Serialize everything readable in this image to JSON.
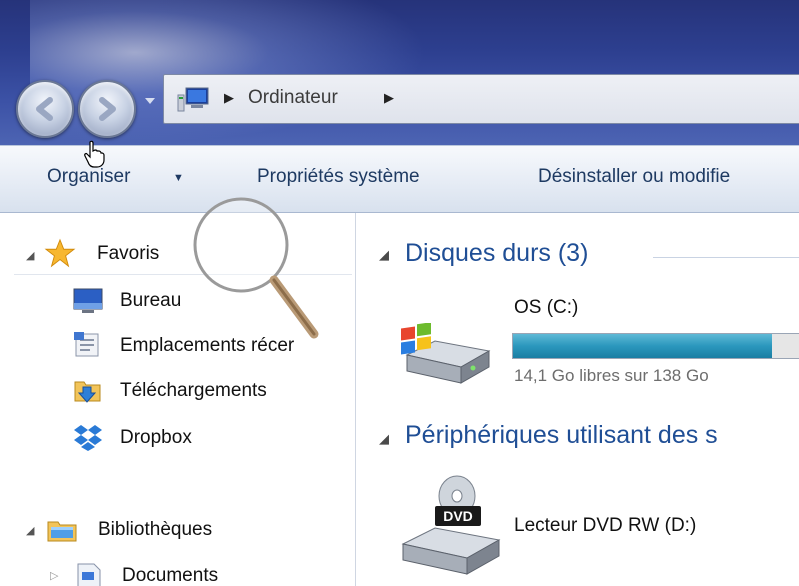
{
  "address_bar": {
    "crumbs": [
      "Ordinateur"
    ],
    "separator": "▶"
  },
  "command_bar": {
    "organiser": "Organiser",
    "organiser_caret": "▼",
    "proprietes": "Propriétés système",
    "desinstaller": "Désinstaller ou modifie"
  },
  "nav_pane": {
    "favoris": {
      "label": "Favoris",
      "items": [
        {
          "label": "Bureau",
          "icon": "desktop-icon"
        },
        {
          "label": "Emplacements récer",
          "icon": "recent-places-icon"
        },
        {
          "label": "Téléchargements",
          "icon": "downloads-folder-icon"
        },
        {
          "label": "Dropbox",
          "icon": "dropbox-icon"
        }
      ]
    },
    "bibliotheques": {
      "label": "Bibliothèques",
      "items": [
        {
          "label": "Documents",
          "icon": "documents-icon"
        }
      ]
    }
  },
  "content": {
    "group_disks": "Disques durs (3)",
    "disk_c": {
      "label": "OS (C:)",
      "free_text": "14,1 Go libres sur 138 Go",
      "used_fraction": 0.9
    },
    "group_removable": "Périphériques utilisant des s",
    "dvd": {
      "label": "Lecteur DVD RW (D:)",
      "badge": "DVD"
    }
  },
  "colors": {
    "titlebar": "#2d3f8f",
    "group_heading": "#1f4e95",
    "disk_bar": "#2b97bd"
  }
}
